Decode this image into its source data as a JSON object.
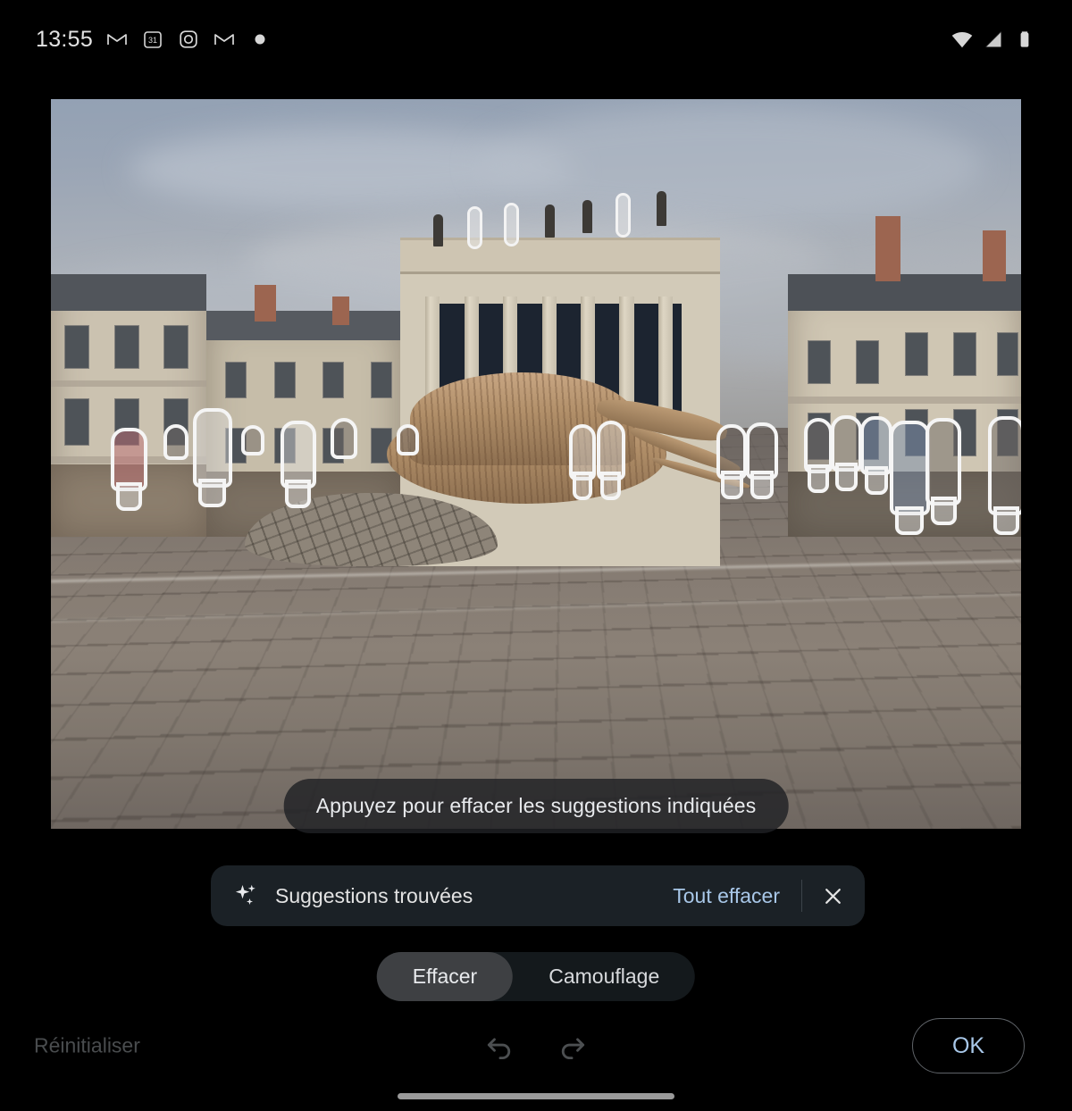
{
  "status_bar": {
    "clock": "13:55",
    "left_icons": [
      {
        "name": "gmail-icon",
        "glyph": "M"
      },
      {
        "name": "calendar-icon",
        "glyph": "31"
      },
      {
        "name": "instagram-icon",
        "glyph": "O"
      },
      {
        "name": "gmail-icon-2",
        "glyph": "M"
      },
      {
        "name": "more-notifications-dot",
        "glyph": "•"
      }
    ],
    "right_icons": [
      {
        "name": "wifi-icon"
      },
      {
        "name": "cellular-signal-icon"
      },
      {
        "name": "battery-icon"
      }
    ]
  },
  "photo": {
    "description": "Place Graslin, Nantes — théâtre néoclassique avec sculpture d'arbre couché sur la place pavée",
    "selection_count": 17,
    "selection_outline_color": "#f5f5f5"
  },
  "toast": {
    "message": "Appuyez pour effacer les suggestions indiquées"
  },
  "suggestion_bar": {
    "icon": "sparkle-icon",
    "label": "Suggestions trouvées",
    "clear_all_label": "Tout effacer",
    "close_label": "×",
    "accent_color": "#a8c7e8",
    "background_color": "#1b2126"
  },
  "mode_toggle": {
    "options": [
      {
        "label": "Effacer",
        "selected": true
      },
      {
        "label": "Camouflage",
        "selected": false
      }
    ],
    "selected_background": "#3e4043"
  },
  "bottom_bar": {
    "reset_label": "Réinitialiser",
    "reset_enabled": false,
    "undo_icon": "undo-icon",
    "redo_icon": "redo-icon",
    "ok_label": "OK",
    "ok_color": "#a8c7e8"
  },
  "system": {
    "home_indicator": "home-indicator"
  }
}
